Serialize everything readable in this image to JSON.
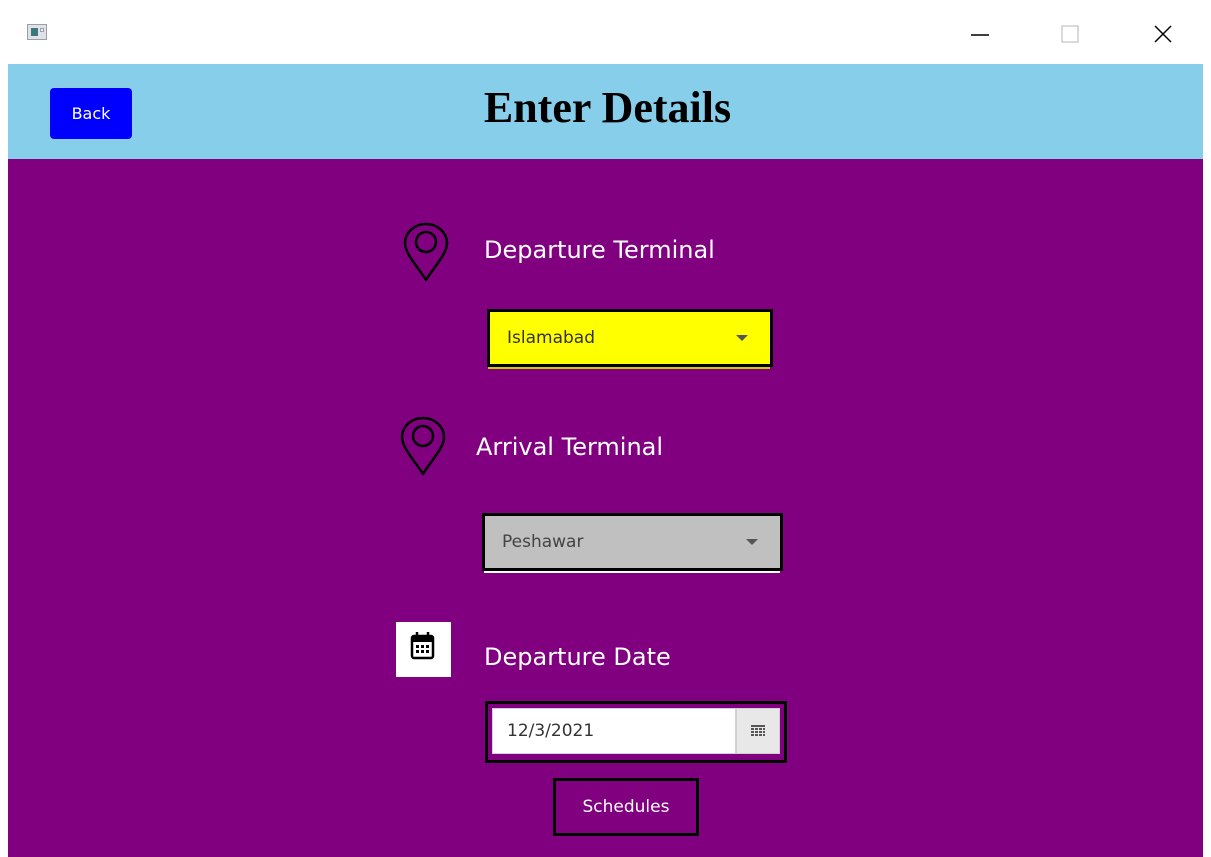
{
  "window": {
    "app_icon": "app-window-icon",
    "controls": {
      "minimize_icon": "minimize-icon",
      "maximize_icon": "maximize-icon",
      "close_icon": "close-icon"
    }
  },
  "header": {
    "back_label": "Back",
    "title": "Enter Details"
  },
  "departure": {
    "icon": "map-pin-icon",
    "label": "Departure Terminal",
    "selected": "Islamabad"
  },
  "arrival": {
    "icon": "map-pin-icon",
    "label": "Arrival Terminal",
    "selected": "Peshawar"
  },
  "date": {
    "icon": "calendar-icon",
    "label": "Departure Date",
    "value": "12/3/2021"
  },
  "actions": {
    "schedules_label": "Schedules"
  },
  "colors": {
    "header_bg": "#87ceeb",
    "body_bg": "#800080",
    "back_bg": "#0000ff",
    "departure_combo_bg": "#ffff00",
    "arrival_combo_bg": "#c0c0c0"
  }
}
